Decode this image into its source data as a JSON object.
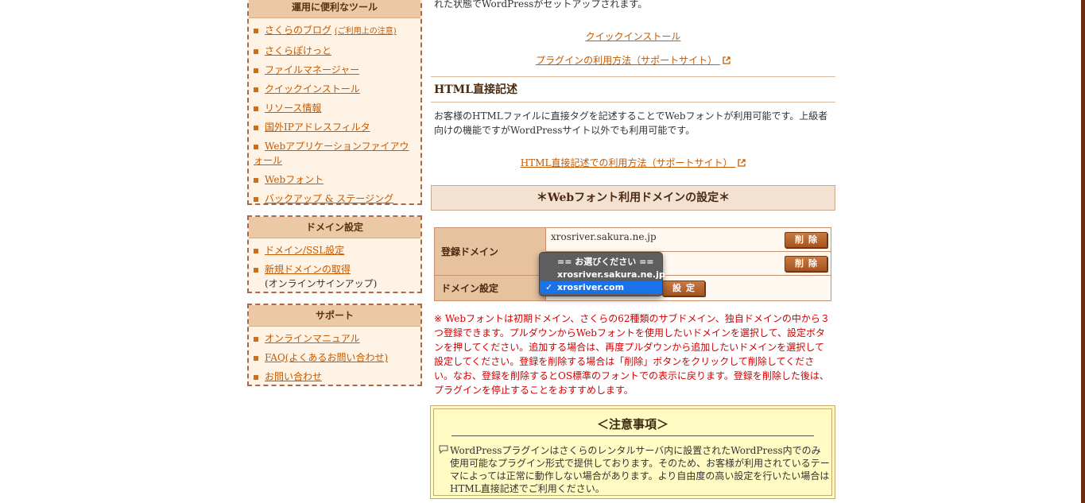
{
  "sidebar": {
    "tools": {
      "title": "運用に便利なツール",
      "items": [
        {
          "label": "さくらのブログ",
          "extra": "(ご利用上の注意)"
        },
        {
          "label": "さくらぽけっと"
        },
        {
          "label": "ファイルマネージャー"
        },
        {
          "label": "クイックインストール"
        },
        {
          "label": "リソース情報"
        },
        {
          "label": "国外IPアドレスフィルタ"
        },
        {
          "label": "Webアプリケーションファイアウォール"
        },
        {
          "label": "Webフォント"
        },
        {
          "label": "バックアップ & ステージング"
        }
      ]
    },
    "domain": {
      "title": "ドメイン設定",
      "items": [
        {
          "label": "ドメイン/SSL設定"
        },
        {
          "label": "新規ドメインの取得",
          "note": "(オンラインサインアップ)"
        }
      ]
    },
    "support": {
      "title": "サポート",
      "items": [
        {
          "label": "オンラインマニュアル"
        },
        {
          "label": "FAQ(よくあるお問い合わせ)"
        },
        {
          "label": "お問い合わせ"
        }
      ]
    }
  },
  "main": {
    "top_text": "れた状態でWordPressがセットアップされます。",
    "quick_install_link": "クイックインストール",
    "plugin_help_link": "プラグインの利用方法（サポートサイト）",
    "html_section_title": "HTML直接記述",
    "html_section_desc": "お客様のHTMLファイルに直接タグを記述することでWebフォントが利用可能です。上級者向けの機能ですがWordPressサイト以外でも利用可能です。",
    "html_help_link": "HTML直接記述での利用方法（サポートサイト）",
    "domain_banner": "＊Webフォント利用ドメインの設定＊",
    "table": {
      "registered_label": "登録ドメイン",
      "registered_value": "xrosriver.sakura.ne.jp",
      "delete_label": "削除",
      "domain_setting_label": "ドメイン設定",
      "set_label": "設定"
    },
    "dropdown": {
      "options": [
        "== お選びください ==",
        "xrosriver.sakura.ne.jp",
        "xrosriver.com"
      ],
      "selected": "xrosriver.com",
      "check": "✓"
    },
    "warning": "※ Webフォントは初期ドメイン、さくらの62種類のサブドメイン、独自ドメインの中から３つ登録できます。プルダウンからWebフォントを使用したいドメインを選択して、設定ボタンを押してください。追加する場合は、再度プルダウンから追加したいドメインを選択して設定してください。登録を削除する場合は「削除」ボタンをクリックして削除してください。なお、登録を削除するとOS標準のフォントでの表示に戻ります。登録を削除した後は、プラグインを停止することをおすすめします。",
    "notice": {
      "title": "＜注意事項＞",
      "body": "WordPressプラグインはさくらのレンタルサーバ内に設置されたWordPress内でのみ使用可能なプラグイン形式で提供しております。そのため、お客様が利用されているテーマによっては正常に動作しない場合があります。より自由度の高い設定を行いたい場合はHTML直接記述でご利用ください。"
    }
  },
  "colors": {
    "accent_link": "#c55a00",
    "sidebar_header": "#ecc9a5",
    "warning_text": "#d10000",
    "notice_bg": "#fffbc2",
    "button": "#b0602a",
    "dropdown_selected": "#1a72e8"
  }
}
